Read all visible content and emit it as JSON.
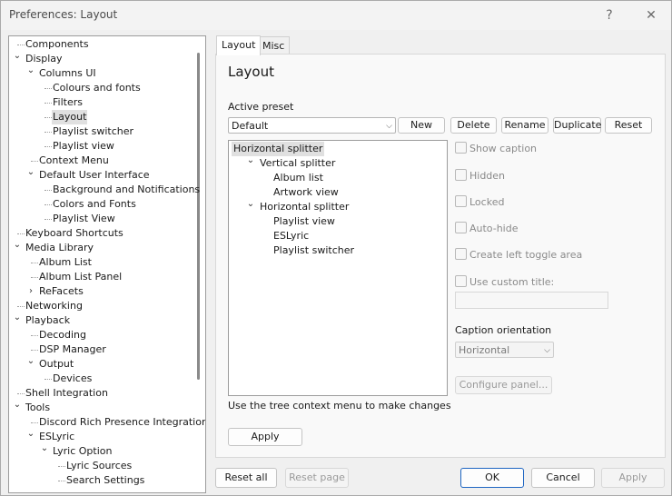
{
  "window": {
    "title": "Preferences: Layout",
    "help_glyph": "?",
    "close_glyph": "✕"
  },
  "tree": {
    "items": [
      {
        "label": "Components",
        "level": 0,
        "expander": ""
      },
      {
        "label": "Display",
        "level": 0,
        "expander": "down"
      },
      {
        "label": "Columns UI",
        "level": 1,
        "expander": "down"
      },
      {
        "label": "Colours and fonts",
        "level": 2,
        "expander": ""
      },
      {
        "label": "Filters",
        "level": 2,
        "expander": ""
      },
      {
        "label": "Layout",
        "level": 2,
        "expander": "",
        "selected": true
      },
      {
        "label": "Playlist switcher",
        "level": 2,
        "expander": ""
      },
      {
        "label": "Playlist view",
        "level": 2,
        "expander": ""
      },
      {
        "label": "Context Menu",
        "level": 1,
        "expander": ""
      },
      {
        "label": "Default User Interface",
        "level": 1,
        "expander": "down"
      },
      {
        "label": "Background and Notifications",
        "level": 2,
        "expander": ""
      },
      {
        "label": "Colors and Fonts",
        "level": 2,
        "expander": ""
      },
      {
        "label": "Playlist View",
        "level": 2,
        "expander": ""
      },
      {
        "label": "Keyboard Shortcuts",
        "level": 0,
        "expander": ""
      },
      {
        "label": "Media Library",
        "level": 0,
        "expander": "down"
      },
      {
        "label": "Album List",
        "level": 1,
        "expander": ""
      },
      {
        "label": "Album List Panel",
        "level": 1,
        "expander": ""
      },
      {
        "label": "ReFacets",
        "level": 1,
        "expander": "right"
      },
      {
        "label": "Networking",
        "level": 0,
        "expander": ""
      },
      {
        "label": "Playback",
        "level": 0,
        "expander": "down"
      },
      {
        "label": "Decoding",
        "level": 1,
        "expander": ""
      },
      {
        "label": "DSP Manager",
        "level": 1,
        "expander": ""
      },
      {
        "label": "Output",
        "level": 1,
        "expander": "down"
      },
      {
        "label": "Devices",
        "level": 2,
        "expander": ""
      },
      {
        "label": "Shell Integration",
        "level": 0,
        "expander": ""
      },
      {
        "label": "Tools",
        "level": 0,
        "expander": "down"
      },
      {
        "label": "Discord Rich Presence Integration",
        "level": 1,
        "expander": ""
      },
      {
        "label": "ESLyric",
        "level": 1,
        "expander": "down"
      },
      {
        "label": "Lyric Option",
        "level": 2,
        "expander": "down"
      },
      {
        "label": "Lyric Sources",
        "level": 3,
        "expander": ""
      },
      {
        "label": "Search Settings",
        "level": 3,
        "expander": ""
      }
    ]
  },
  "tabs": [
    {
      "label": "Layout",
      "active": true
    },
    {
      "label": "Misc",
      "active": false
    }
  ],
  "layout_page": {
    "heading": "Layout",
    "active_preset_label": "Active preset",
    "preset_value": "Default",
    "preset_buttons": [
      "New",
      "Delete",
      "Rename",
      "Duplicate",
      "Reset"
    ],
    "layout_tree": [
      {
        "label": "Horizontal splitter",
        "level": 0,
        "expander": "",
        "selected": true
      },
      {
        "label": "Vertical splitter",
        "level": 1,
        "expander": "down"
      },
      {
        "label": "Album list",
        "level": 2,
        "expander": ""
      },
      {
        "label": "Artwork view",
        "level": 2,
        "expander": ""
      },
      {
        "label": "Horizontal splitter",
        "level": 1,
        "expander": "down"
      },
      {
        "label": "Playlist view",
        "level": 2,
        "expander": ""
      },
      {
        "label": "ESLyric",
        "level": 2,
        "expander": ""
      },
      {
        "label": "Playlist switcher",
        "level": 2,
        "expander": ""
      }
    ],
    "options": [
      "Show caption",
      "Hidden",
      "Locked",
      "Auto-hide",
      "Create left toggle area",
      "Use custom title:"
    ],
    "custom_title_value": "",
    "caption_orientation_label": "Caption orientation",
    "caption_orientation_value": "Horizontal",
    "configure_panel_label": "Configure panel...",
    "hint": "Use the tree context menu to make changes",
    "apply_label": "Apply"
  },
  "footer": {
    "reset_all": "Reset all",
    "reset_page": "Reset page",
    "ok": "OK",
    "cancel": "Cancel",
    "apply": "Apply"
  },
  "colors": {
    "accent_border": "#1f66c2",
    "selection": "#e0e0e0"
  }
}
